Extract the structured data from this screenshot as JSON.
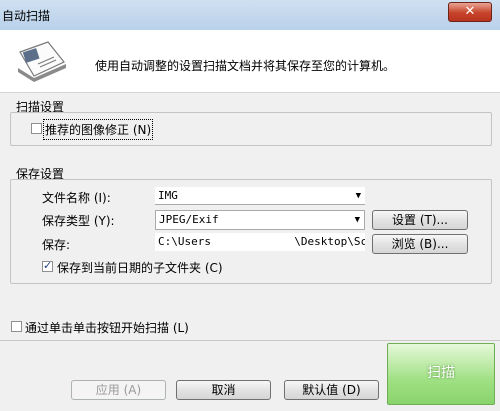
{
  "window": {
    "title": "自动扫描",
    "close_glyph": "✕"
  },
  "header": {
    "description": "使用自动调整的设置扫描文档并将其保存至您的计算机。",
    "icon": "scanner-document-icon"
  },
  "scan_settings": {
    "group_label": "扫描设置",
    "recommended_correction": {
      "label": "推荐的图像修正 (N)",
      "checked": false
    }
  },
  "save_settings": {
    "group_label": "保存设置",
    "file_name": {
      "label": "文件名称 (I):",
      "value": "IMG"
    },
    "save_type": {
      "label": "保存类型 (Y):",
      "value": "JPEG/Exif",
      "settings_button": "设置 (T)..."
    },
    "save_location": {
      "label": "保存:",
      "value_prefix": "C:\\Users",
      "value_suffix": "\\Desktop\\Sca",
      "browse_button": "浏览 (B)..."
    },
    "date_subfolder": {
      "label": "保存到当前日期的子文件夹 (C)",
      "checked": true
    }
  },
  "start_by_button": {
    "label": "通过单击单击按钮开始扫描 (L)",
    "checked": false
  },
  "footer": {
    "apply_button": "应用 (A)",
    "cancel_button": "取消",
    "defaults_button": "默认值 (D)",
    "scan_button": "扫描"
  }
}
